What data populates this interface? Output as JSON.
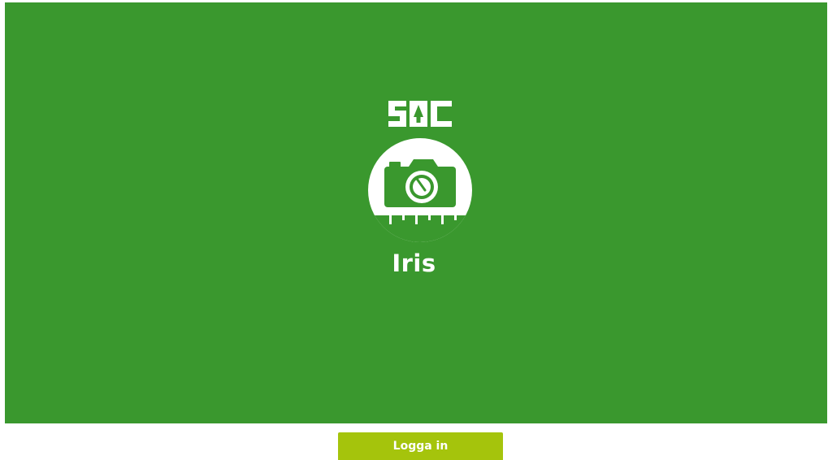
{
  "brand": {
    "logo_text": "SDC",
    "logo_icon": "sdc-logo-icon"
  },
  "app": {
    "name": "Iris",
    "icon": "camera-ruler-icon"
  },
  "login": {
    "label": "Logga in"
  },
  "colors": {
    "splash_background": "#3a982e",
    "button_background": "#a5c40c",
    "text": "#ffffff"
  }
}
